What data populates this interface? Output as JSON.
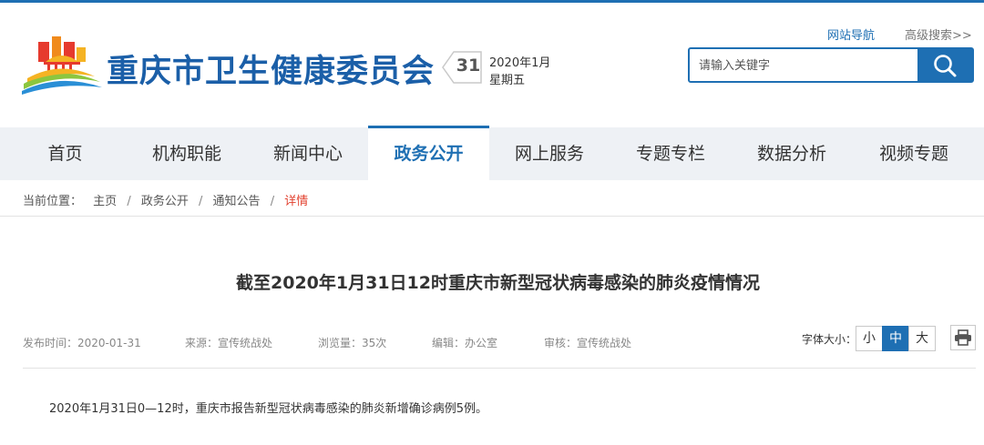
{
  "header": {
    "site_name": "重庆市卫生健康委员会",
    "calendar_day": "31",
    "date_line1": "2020年1月",
    "date_line2": "星期五",
    "links": {
      "site_nav": "网站导航",
      "advanced_search": "高级搜索>>"
    },
    "search": {
      "placeholder": "请输入关键字",
      "icon": "search-icon"
    }
  },
  "nav": {
    "items": [
      "首页",
      "机构职能",
      "新闻中心",
      "政务公开",
      "网上服务",
      "专题专栏",
      "数据分析",
      "视频专题"
    ],
    "active": "政务公开"
  },
  "breadcrumb": {
    "label": "当前位置：",
    "items": [
      "主页",
      "政务公开",
      "通知公告",
      "详情"
    ]
  },
  "article": {
    "title": "截至2020年1月31日12时重庆市新型冠状病毒感染的肺炎疫情情况",
    "meta": {
      "publish_time": "发布时间：2020-01-31",
      "source": "来源：宣传统战处",
      "views": "浏览量：35次",
      "editor": "编辑：办公室",
      "reviewer": "审核：宣传统战处"
    },
    "font_size": {
      "label": "字体大小：",
      "small": "小",
      "medium": "中",
      "large": "大",
      "selected": "中"
    },
    "print_icon": "printer-icon",
    "paragraph": "2020年1月31日0—12时，重庆市报告新型冠状病毒感染的肺炎新增确诊病例5例。"
  },
  "colors": {
    "brand_blue": "#1e6fb3",
    "current_crumb": "#e2412f",
    "nav_bg": "#eef1f5"
  }
}
